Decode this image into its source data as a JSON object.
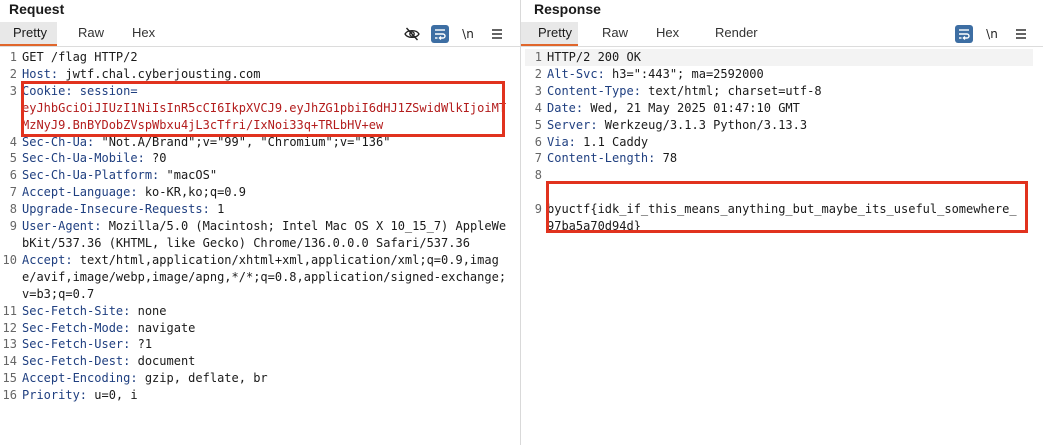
{
  "request": {
    "title": "Request",
    "tabs": [
      "Pretty",
      "Raw",
      "Hex"
    ],
    "active_tab": "Pretty",
    "toolbar": {
      "hide_icon": "eye-slash-icon",
      "wrap_icon": "wrap-lines-icon",
      "newline_label": "\\n",
      "menu_icon": "hamburger-menu-icon"
    },
    "lines": [
      {
        "n": "1",
        "text": "GET /flag HTTP/2"
      },
      {
        "n": "2",
        "name": "Host:",
        "value": " jwtf.chal.cyberjousting.com"
      },
      {
        "n": "3",
        "name": "Cookie:",
        "value": " session=",
        "cookie": "eyJhbGciOiJIUzI1NiIsInR5cCI6IkpXVCJ9.eyJhZG1pbiI6dHJ1ZSwidWlkIjoiMTMzNyJ9.BnBYDobZVspWbxu4jL3cTfri/IxNoi33q+TRLbHV+ew"
      },
      {
        "n": "4",
        "name": "Sec-Ch-Ua:",
        "value": " \"Not.A/Brand\";v=\"99\", \"Chromium\";v=\"136\""
      },
      {
        "n": "5",
        "name": "Sec-Ch-Ua-Mobile:",
        "value": " ?0"
      },
      {
        "n": "6",
        "name": "Sec-Ch-Ua-Platform:",
        "value": " \"macOS\""
      },
      {
        "n": "7",
        "name": "Accept-Language:",
        "value": " ko-KR,ko;q=0.9"
      },
      {
        "n": "8",
        "name": "Upgrade-Insecure-Requests:",
        "value": " 1"
      },
      {
        "n": "9",
        "name": "User-Agent:",
        "value": " Mozilla/5.0 (Macintosh; Intel Mac OS X 10_15_7) AppleWebKit/537.36 (KHTML, like Gecko) Chrome/136.0.0.0 Safari/537.36"
      },
      {
        "n": "10",
        "name": "Accept:",
        "value": " text/html,application/xhtml+xml,application/xml;q=0.9,image/avif,image/webp,image/apng,*/*;q=0.8,application/signed-exchange;v=b3;q=0.7"
      },
      {
        "n": "11",
        "name": "Sec-Fetch-Site:",
        "value": " none"
      },
      {
        "n": "12",
        "name": "Sec-Fetch-Mode:",
        "value": " navigate"
      },
      {
        "n": "13",
        "name": "Sec-Fetch-User:",
        "value": " ?1"
      },
      {
        "n": "14",
        "name": "Sec-Fetch-Dest:",
        "value": " document"
      },
      {
        "n": "15",
        "name": "Accept-Encoding:",
        "value": " gzip, deflate, br"
      },
      {
        "n": "16",
        "name": "Priority:",
        "value": " u=0, i"
      }
    ]
  },
  "response": {
    "title": "Response",
    "tabs": [
      "Pretty",
      "Raw",
      "Hex",
      "Render"
    ],
    "active_tab": "Pretty",
    "toolbar": {
      "wrap_icon": "wrap-lines-icon",
      "newline_label": "\\n",
      "menu_icon": "hamburger-menu-icon"
    },
    "lines": [
      {
        "n": "1",
        "text": "HTTP/2 200 OK"
      },
      {
        "n": "2",
        "name": "Alt-Svc:",
        "value": " h3=\":443\"; ma=2592000"
      },
      {
        "n": "3",
        "name": "Content-Type:",
        "value": " text/html; charset=utf-8"
      },
      {
        "n": "4",
        "name": "Date:",
        "value": " Wed, 21 May 2025 01:47:10 GMT"
      },
      {
        "n": "5",
        "name": "Server:",
        "value": " Werkzeug/3.1.3 Python/3.13.3"
      },
      {
        "n": "6",
        "name": "Via:",
        "value": " 1.1 Caddy"
      },
      {
        "n": "7",
        "name": "Content-Length:",
        "value": " 78"
      },
      {
        "n": "8",
        "text": ""
      },
      {
        "n": "9",
        "text": "byuctf{idk_if_this_means_anything_but_maybe_its_useful_somewhere_97ba5a70d94d}"
      }
    ]
  },
  "colors": {
    "accent_tab": "#e0662b",
    "highlight_box": "#e1321e",
    "header_name": "#1f3f80",
    "cookie_value": "#b31c1c",
    "wrap_button": "#3d6ea3"
  }
}
